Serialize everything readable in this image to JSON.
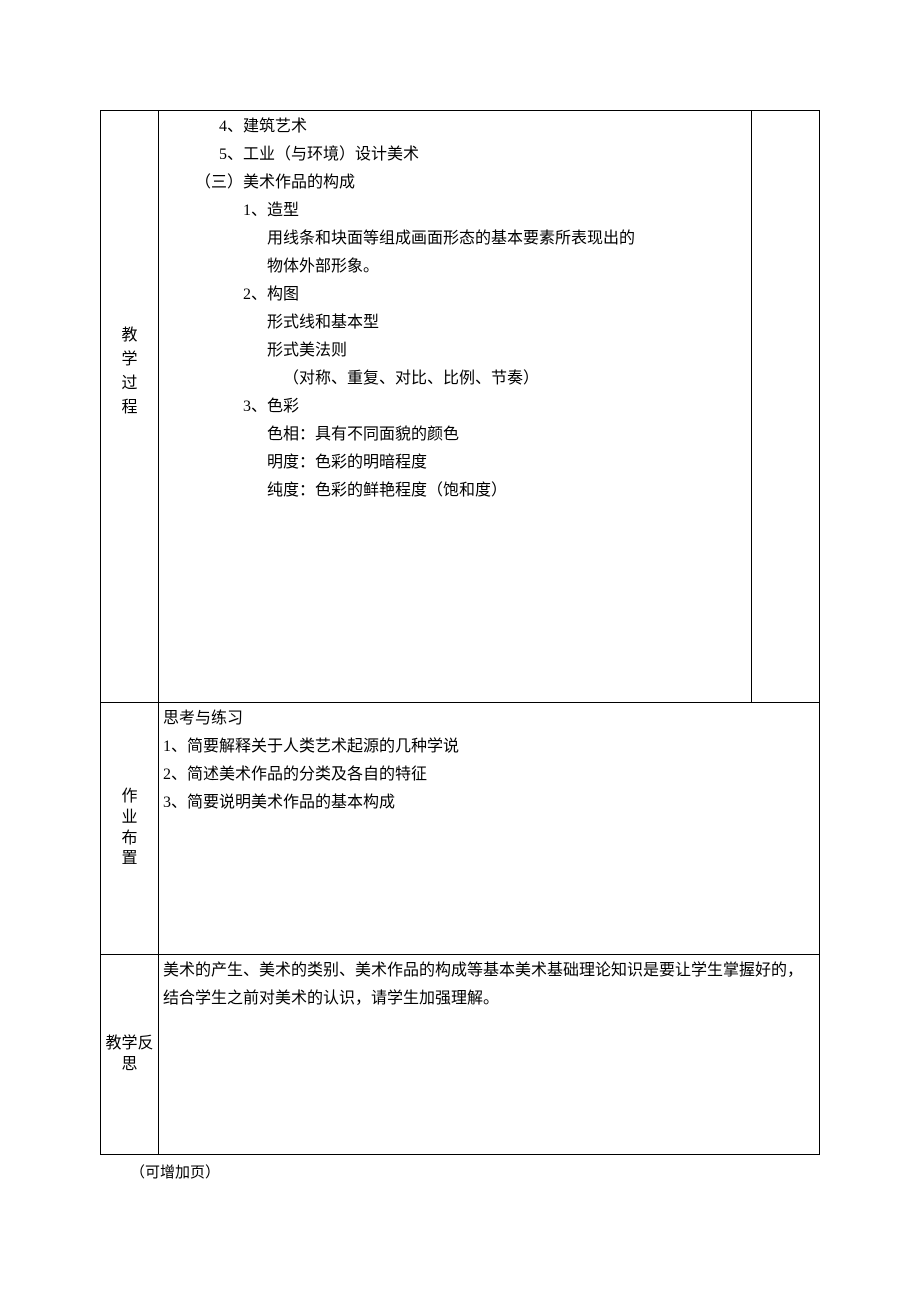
{
  "labels": {
    "process": {
      "c1": "教",
      "c2": "学",
      "c3": "过",
      "c4": "程"
    },
    "homework": {
      "c1": "作",
      "c2": "业",
      "c3": "布",
      "c4": "置"
    },
    "reflect": {
      "c1": "教学反",
      "c2": "思"
    }
  },
  "process": {
    "l1": "4、建筑艺术",
    "l2": "5、工业（与环境）设计美术",
    "l3": "（三）美术作品的构成",
    "l4": "1、造型",
    "l5": "用线条和块面等组成画面形态的基本要素所表现出的",
    "l6": "物体外部形象。",
    "l7": "2、构图",
    "l8": "形式线和基本型",
    "l9": "形式美法则",
    "l10": "（对称、重复、对比、比例、节奏）",
    "l11": "3、色彩",
    "l12": "色相：具有不同面貌的颜色",
    "l13": "明度：色彩的明暗程度",
    "l14": "纯度：色彩的鲜艳程度（饱和度）"
  },
  "homework": {
    "title": "思考与练习",
    "q1": "1、简要解释关于人类艺术起源的几种学说",
    "q2": "2、简述美术作品的分类及各自的特征",
    "q3": "3、简要说明美术作品的基本构成"
  },
  "reflect": {
    "text": "美术的产生、美术的类别、美术作品的构成等基本美术基础理论知识是要让学生掌握好的，结合学生之前对美术的认识，请学生加强理解。"
  },
  "footnote": "（可增加页）"
}
